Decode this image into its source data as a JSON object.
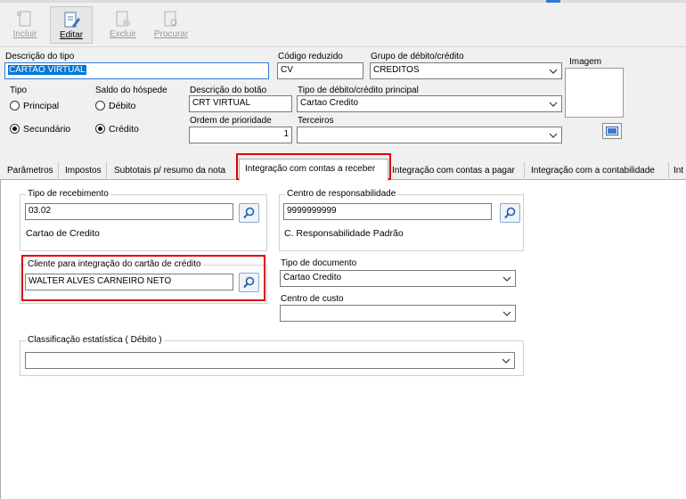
{
  "toolbar": {
    "incluir": "Incluir",
    "editar": "Editar",
    "excluir": "Excluir",
    "procurar": "Procurar"
  },
  "form": {
    "descricao_tipo_label": "Descrição do tipo",
    "descricao_tipo_value": "CARTAO VIRTUAL",
    "codigo_reduzido_label": "Código reduzido",
    "codigo_reduzido_value": "CV",
    "grupo_label": "Grupo de débito/crédito",
    "grupo_value": "CREDITOS",
    "imagem_label": "Imagem",
    "tipo_label": "Tipo",
    "tipo_principal": "Principal",
    "tipo_secundario": "Secundário",
    "saldo_label": "Saldo do hóspede",
    "saldo_debito": "Débito",
    "saldo_credito": "Crédito",
    "descricao_botao_label": "Descrição do botão",
    "descricao_botao_value": "CRT VIRTUAL",
    "tipo_dc_label": "Tipo de débito/crédito principal",
    "tipo_dc_value": "Cartao Credito",
    "ordem_label": "Ordem de prioridade",
    "ordem_value": "1",
    "terceiros_label": "Terceiros",
    "terceiros_value": ""
  },
  "tabs": [
    "Parâmetros",
    "Impostos",
    "Subtotais p/ resumo da nota",
    "Integração com contas a receber",
    "Integração com contas a pagar",
    "Integração com a contabilidade",
    "Int"
  ],
  "panel": {
    "tipo_recebimento_label": "Tipo de recebimento",
    "tipo_recebimento_value": "03.02",
    "tipo_recebimento_desc": "Cartao de Credito",
    "centro_resp_label": "Centro de responsabilidade",
    "centro_resp_value": "9999999999",
    "centro_resp_desc": "C. Responsabilidade Padrão",
    "cliente_label": "Cliente para integração do cartão de crédito",
    "cliente_value": "WALTER ALVES CARNEIRO NETO",
    "tipo_documento_label": "Tipo de documento",
    "tipo_documento_value": "Cartao Credito",
    "centro_custo_label": "Centro de custo",
    "centro_custo_value": "",
    "classificacao_label": "Classificação estatística ( Débito )",
    "classificacao_value": ""
  },
  "colors": {
    "selection": "#0078d7",
    "highlight_box": "#e00000",
    "search_button_border": "#8aa9c9"
  }
}
